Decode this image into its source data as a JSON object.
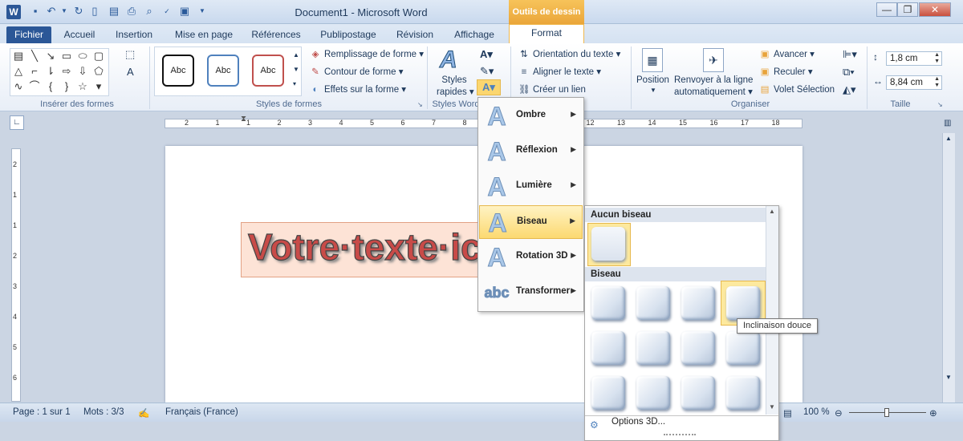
{
  "window": {
    "title": "Document1 - Microsoft Word",
    "contextual_tab": "Outils de dessin",
    "minimize": "—",
    "restore": "❐",
    "close": "✕"
  },
  "quick_access": [
    "save-icon",
    "undo-icon",
    "redo-icon",
    "new-doc-icon",
    "open-icon",
    "print-icon",
    "preview-icon",
    "spelling-icon",
    "screenshot-icon",
    "customize-icon"
  ],
  "tabs": {
    "file": "Fichier",
    "home": "Accueil",
    "insert": "Insertion",
    "layout": "Mise en page",
    "references": "Références",
    "mailings": "Publipostage",
    "review": "Révision",
    "view": "Affichage",
    "format": "Format"
  },
  "ribbon": {
    "groups": {
      "insert_shapes": "Insérer des formes",
      "shape_styles": "Styles de formes",
      "wordart_styles": "Styles Word",
      "arrange": "Organiser",
      "size": "Taille"
    },
    "style_samples": [
      "Abc",
      "Abc",
      "Abc"
    ],
    "shape_fill": "Remplissage de forme",
    "shape_outline": "Contour de forme",
    "shape_effects": "Effets sur la forme",
    "quick_styles_1": "Styles",
    "quick_styles_2": "rapides",
    "text_direction": "Orientation du texte",
    "align_text": "Aligner le texte",
    "create_link": "Créer un lien",
    "position": "Position",
    "wrap_text_1": "Renvoyer à la ligne",
    "wrap_text_2": "automatiquement",
    "bring_forward": "Avancer",
    "send_backward": "Reculer",
    "selection_pane": "Volet Sélection",
    "height": "1,8 cm",
    "width": "8,84 cm"
  },
  "document": {
    "wordart_text": "Votre·texte·ici"
  },
  "effects_menu": {
    "items": [
      {
        "label": "Ombre"
      },
      {
        "label": "Réflexion"
      },
      {
        "label": "Lumière"
      },
      {
        "label": "Biseau"
      },
      {
        "label": "Rotation 3D"
      },
      {
        "label": "Transformer"
      }
    ],
    "active_item": "Biseau"
  },
  "bevel_gallery": {
    "no_bevel_header": "Aucun biseau",
    "bevel_header": "Biseau",
    "tooltip": "Inclinaison douce",
    "options_3d": "Options 3D..."
  },
  "status": {
    "page": "Page : 1 sur 1",
    "words": "Mots : 3/3",
    "language": "Français (France)",
    "zoom": "100 %"
  },
  "ruler_ticks": [
    "2",
    "1",
    "1",
    "2",
    "3",
    "4",
    "5",
    "6",
    "7",
    "8",
    "9",
    "10",
    "11",
    "12",
    "13",
    "14",
    "15",
    "16",
    "17",
    "18"
  ]
}
